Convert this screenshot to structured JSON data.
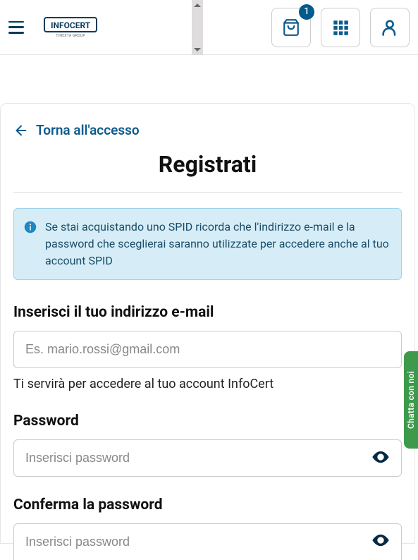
{
  "header": {
    "logo_text": "INFOCERT",
    "logo_sub": "TINEXTA GROUP",
    "cart_badge": "1"
  },
  "back": {
    "label": "Torna all'accesso"
  },
  "page": {
    "title": "Registrati"
  },
  "info": {
    "text": "Se stai acquistando uno SPID ricorda che l'indirizzo e-mail e la password che sceglierai saranno utilizzate per accedere anche al tuo account SPID"
  },
  "email": {
    "label": "Inserisci il tuo indirizzo e-mail",
    "placeholder": "Es. mario.rossi@gmail.com",
    "helper": "Ti servirà per accedere al tuo account InfoCert"
  },
  "password": {
    "label": "Password",
    "placeholder": "Inserisci password"
  },
  "confirm": {
    "label": "Conferma la password",
    "placeholder": "Inserisci password"
  },
  "chat": {
    "label": "Chatta con noi"
  }
}
